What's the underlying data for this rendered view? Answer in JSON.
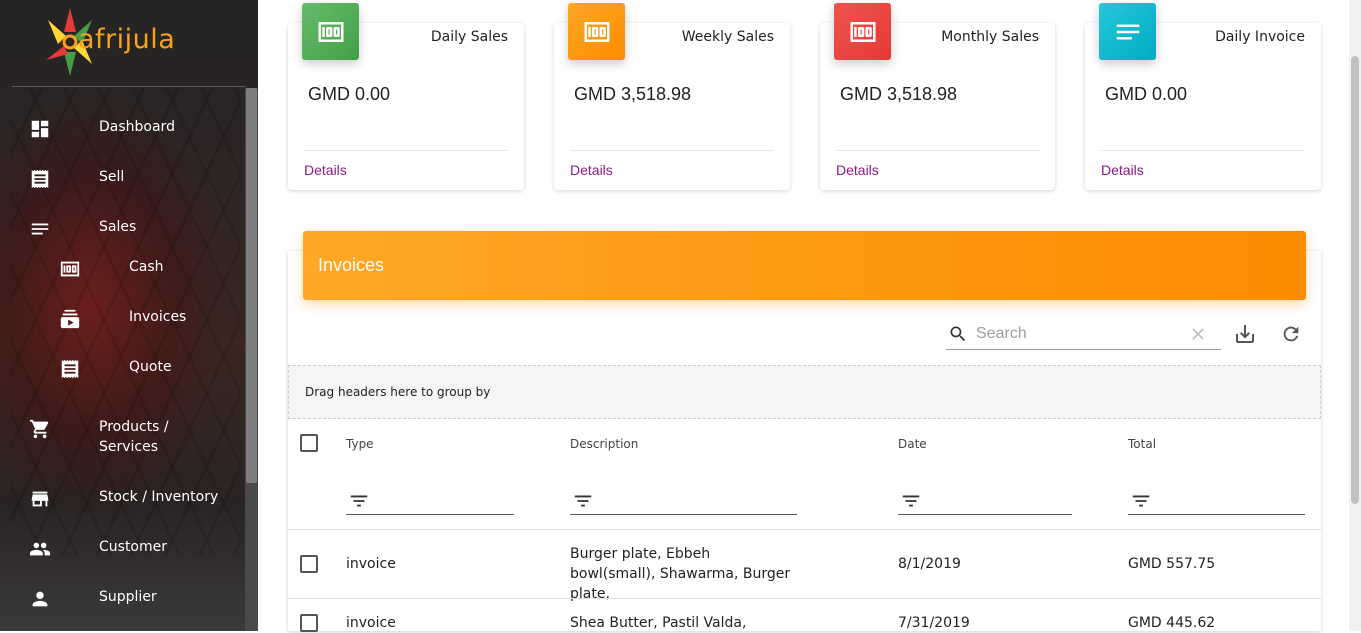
{
  "app": {
    "logo_text": "afrijula"
  },
  "sidebar": {
    "items": [
      {
        "label": "Dashboard",
        "icon": "dashboard-icon"
      },
      {
        "label": "Sell",
        "icon": "receipt-icon"
      },
      {
        "label": "Sales",
        "icon": "list-icon"
      },
      {
        "label": "Cash",
        "icon": "money-icon"
      },
      {
        "label": "Invoices",
        "icon": "subscriptions-icon"
      },
      {
        "label": "Quote",
        "icon": "receipt-icon"
      },
      {
        "label": "Products / Services",
        "icon": "cart-icon"
      },
      {
        "label": "Stock / Inventory",
        "icon": "store-icon"
      },
      {
        "label": "Customer",
        "icon": "people-icon"
      },
      {
        "label": "Supplier",
        "icon": "person-icon"
      }
    ]
  },
  "cards": [
    {
      "title": "Daily Sales",
      "value": "GMD 0.00",
      "link": "Details",
      "color": "#4caf50",
      "icon": "money-icon"
    },
    {
      "title": "Weekly Sales",
      "value": "GMD 3,518.98",
      "link": "Details",
      "color": "#ff9800",
      "icon": "money-icon"
    },
    {
      "title": "Monthly Sales",
      "value": "GMD 3,518.98",
      "link": "Details",
      "color": "#e53935",
      "icon": "money-icon"
    },
    {
      "title": "Daily Invoice",
      "value": "GMD 0.00",
      "link": "Details",
      "color": "#00acc1",
      "icon": "notes-icon"
    }
  ],
  "invoices": {
    "title": "Invoices",
    "search_placeholder": "Search",
    "group_hint": "Drag headers here to group by",
    "columns": [
      "Type",
      "Description",
      "Date",
      "Total"
    ],
    "rows": [
      {
        "type": "invoice",
        "description": "Burger plate, Ebbeh bowl(small), Shawarma, Burger plate,",
        "date": "8/1/2019",
        "total": "GMD 557.75"
      },
      {
        "type": "invoice",
        "description": "Shea Butter, Pastil Valda,",
        "date": "7/31/2019",
        "total": "GMD 445.62"
      }
    ]
  },
  "colors": {
    "accent": "#fb8c00",
    "link": "#8b1a8b"
  }
}
